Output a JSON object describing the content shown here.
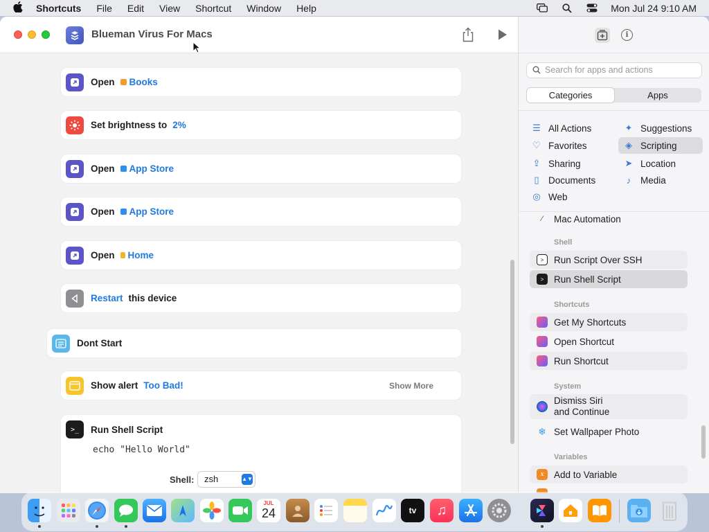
{
  "menubar": {
    "apple": "",
    "app": "Shortcuts",
    "items": [
      "File",
      "Edit",
      "View",
      "Shortcut",
      "Window",
      "Help"
    ],
    "clock": "Mon Jul 24  9:10 AM"
  },
  "window": {
    "title": "Blueman Virus For Macs"
  },
  "actions": [
    {
      "verb": "Open",
      "token": "Books",
      "token_color": "#f39c2c",
      "icon_color": "#5b55c9"
    },
    {
      "verb": "Set brightness to",
      "token": "2%",
      "icon_color": "#f04a3e"
    },
    {
      "verb": "Open",
      "token": "App Store",
      "token_color": "#2f8ff0",
      "icon_color": "#5b55c9"
    },
    {
      "verb": "Open",
      "token": "App Store",
      "token_color": "#2f8ff0",
      "icon_color": "#5b55c9"
    },
    {
      "verb": "Open",
      "token": "Home",
      "token_color": "#f3b22c",
      "icon_color": "#5b55c9"
    },
    {
      "verb_token": "Restart",
      "after": "this device",
      "icon_color": "#8e8e93"
    }
  ],
  "comment": {
    "text": "Dont Start"
  },
  "alert": {
    "verb": "Show alert",
    "token": "Too Bad!",
    "show_more": "Show More"
  },
  "shell": {
    "title": "Run Shell Script",
    "code": "echo \"Hello World\"",
    "shell_label": "Shell:",
    "shell_value": "zsh"
  },
  "sidebar": {
    "search_placeholder": "Search for apps and actions",
    "tabs": [
      "Categories",
      "Apps"
    ],
    "categories_left": [
      "All Actions",
      "Favorites",
      "Sharing",
      "Documents",
      "Web"
    ],
    "categories_right": [
      "Suggestions",
      "Scripting",
      "Location",
      "Media"
    ],
    "selected_category": "Scripting",
    "partial_item": "Mac Automation",
    "sections": {
      "shell": {
        "header": "Shell",
        "items": [
          "Run Script Over SSH",
          "Run Shell Script"
        ]
      },
      "shortcuts": {
        "header": "Shortcuts",
        "items": [
          "Get My Shortcuts",
          "Open Shortcut",
          "Run Shortcut"
        ]
      },
      "system": {
        "header": "System",
        "items": [
          "Dismiss Siri\nand Continue",
          "Set Wallpaper Photo"
        ]
      },
      "variables": {
        "header": "Variables",
        "items": [
          "Add to Variable"
        ]
      }
    }
  },
  "dock": {
    "calendar_month": "JUL",
    "calendar_day": "24",
    "tv_label": "tv"
  },
  "colors": {
    "accent": "#1f7ae0",
    "token": "#1f7ae0"
  }
}
